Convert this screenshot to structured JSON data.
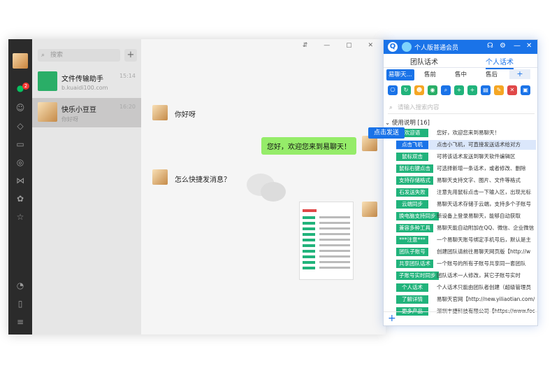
{
  "wechat": {
    "search_placeholder": "搜索",
    "add_label": "+",
    "unread_badge": "2",
    "sessions": [
      {
        "name": "文件传输助手",
        "sub": "b.kuaidi100.com",
        "time": "15:14"
      },
      {
        "name": "快乐小豆豆",
        "sub": "你好呀",
        "time": "16:20"
      }
    ],
    "window_controls": "⇵ — ▢ ✕",
    "messages": {
      "incoming_1": "你好呀",
      "outgoing_1": "您好，欢迎您来到易聊天！",
      "incoming_2": "怎么快捷发消息？"
    }
  },
  "assistant": {
    "title": "个人版普通会员",
    "logo_letter": "Q",
    "tabs": [
      "团队话术",
      "个人话术"
    ],
    "sub_tabs": [
      "易聊天...",
      "售前",
      "售中",
      "售后"
    ],
    "add_tab": "+",
    "search_placeholder": "请输入搜索内容",
    "group_label": "使用说明 [16]",
    "send_popup": "点击发送",
    "phrases": [
      {
        "tag": "欢迎语",
        "text": "您好，欢迎您来到易聊天！"
      },
      {
        "tag": "点击飞机",
        "text": "点击小飞机，可直接发送话术给对方"
      },
      {
        "tag": "鼠标双击",
        "text": "可将该话术发送到聊天软件编辑区"
      },
      {
        "tag": "鼠标右键点击",
        "text": "可选择新增一条话术，或者修改、删除"
      },
      {
        "tag": "支持存储格式",
        "text": "易聊天支持文字、图片、文件等格式"
      },
      {
        "tag": "石发送失败",
        "text": "注意先用鼠标点击一下输入区，出现光标"
      },
      {
        "tag": "云端同步",
        "text": "易聊天话术存储于云端，支持多个子账号"
      },
      {
        "tag": "换电脑支持同步",
        "text": "新设备上登录易聊天，能够自动获取"
      },
      {
        "tag": "兼容多种工具",
        "text": "易聊天能自动附加在QQ、微信、企业微信"
      },
      {
        "tag": "***注意***",
        "text": "一个易聊天账号绑定手机号后，默认是主"
      },
      {
        "tag": "团队子账号",
        "text": "创建团队请前往易聊天网页版【http://w"
      },
      {
        "tag": "共享团队话术",
        "text": "一个账号的所有子账号共享同一套团队"
      },
      {
        "tag": "子账号实时同步",
        "text": "团队话术一人修改，其它子账号实时"
      },
      {
        "tag": "个人话术",
        "text": "个人话术只能由团队者创建（超级管理员"
      },
      {
        "tag": "了解详情",
        "text": "易聊天官网【http://new.yiliaotian.com/】"
      },
      {
        "tag": "更多产品",
        "text": "深圳丰捷科技有限公司【https://www.foo"
      }
    ]
  },
  "colors": {
    "accent": "#1a73e8",
    "tag_green": "#21b37b",
    "bubble_green": "#95ec69"
  }
}
